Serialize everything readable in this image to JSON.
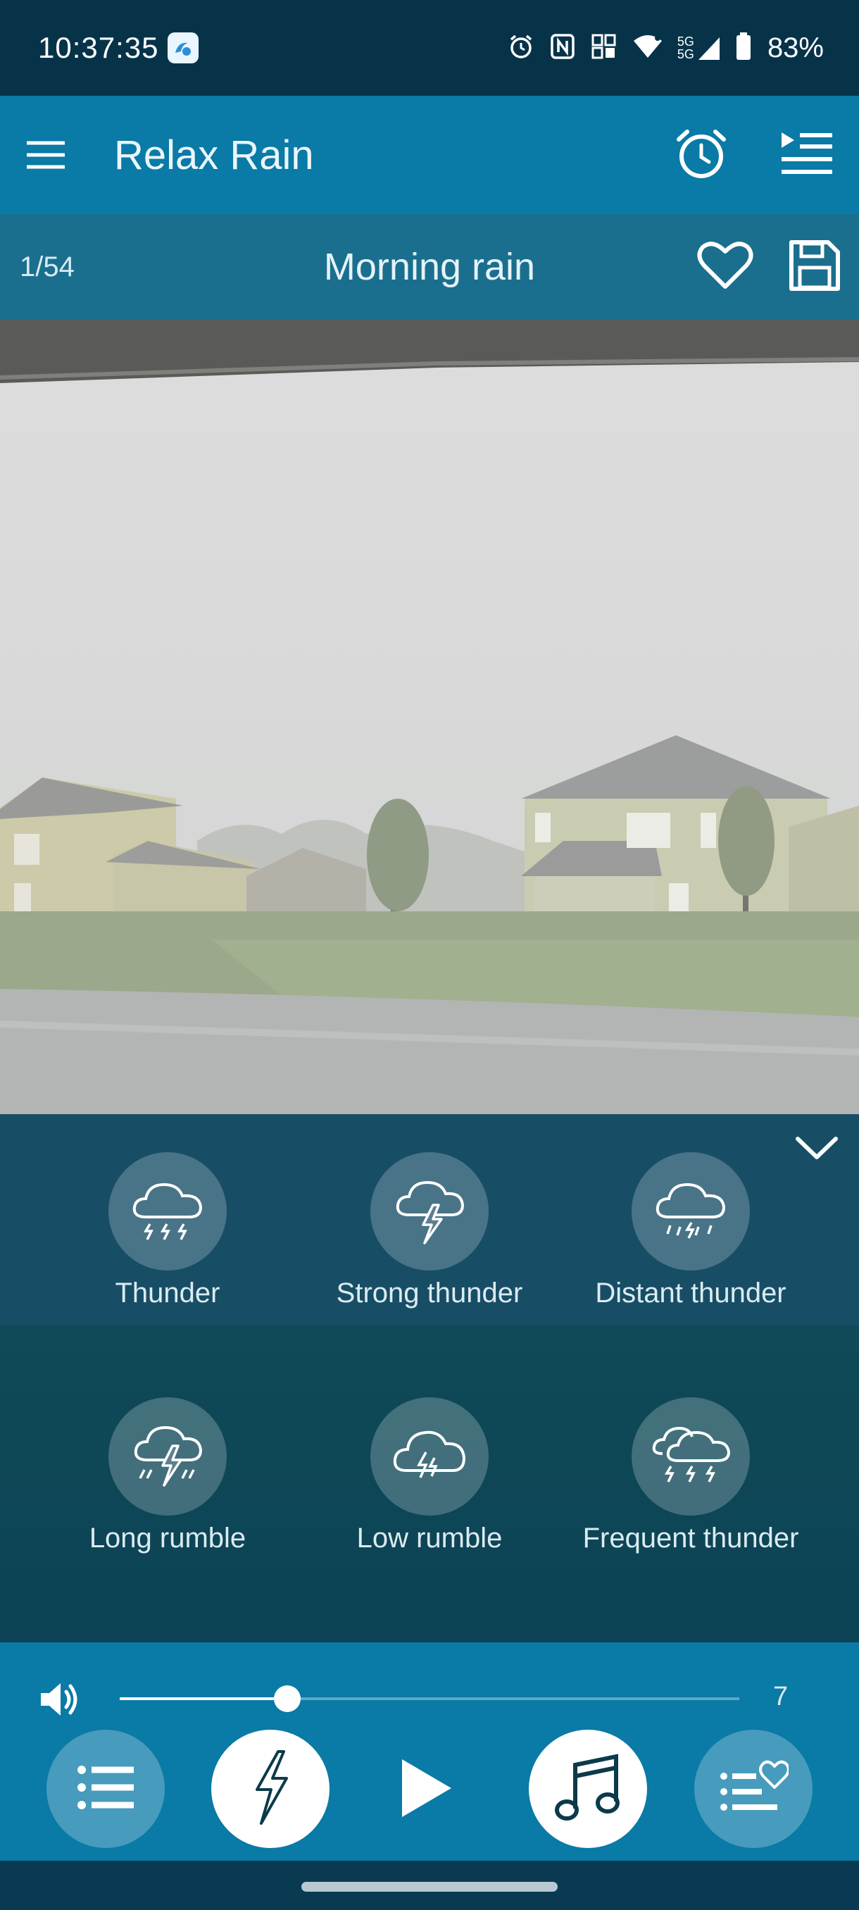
{
  "status_bar": {
    "time": "10:37:35",
    "battery": "83%",
    "icons": [
      "alarm-icon",
      "nfc-icon",
      "vibrate-icon",
      "wifi-icon",
      "5g-signal-icon",
      "battery-icon"
    ],
    "network_label_top": "5G",
    "network_label_bottom": "5G"
  },
  "app_bar": {
    "title": "Relax Rain",
    "icons": [
      "menu-icon",
      "alarm-clock-icon",
      "playlist-icon"
    ]
  },
  "track": {
    "count": "1/54",
    "title": "Morning rain",
    "icons": [
      "heart-icon",
      "save-icon"
    ]
  },
  "sounds": [
    {
      "label": "Thunder",
      "icon": "cloud-thunder-icon"
    },
    {
      "label": "Strong thunder",
      "icon": "cloud-lightning-icon"
    },
    {
      "label": "Distant thunder",
      "icon": "cloud-rain-thunder-icon"
    },
    {
      "label": "Long rumble",
      "icon": "cloud-rumble-icon"
    },
    {
      "label": "Low rumble",
      "icon": "cloud-low-rumble-icon"
    },
    {
      "label": "Frequent thunder",
      "icon": "double-cloud-thunder-icon"
    }
  ],
  "player": {
    "volume_value": "7",
    "volume_fraction": 0.27,
    "controls": [
      "list-icon",
      "lightning-icon",
      "play-icon",
      "music-note-icon",
      "favorite-list-icon"
    ]
  },
  "colors": {
    "app_bar": "#0a7aa6",
    "status_bar": "#073349",
    "track_bar": "#1a6f8e",
    "panel": "#174e66"
  }
}
